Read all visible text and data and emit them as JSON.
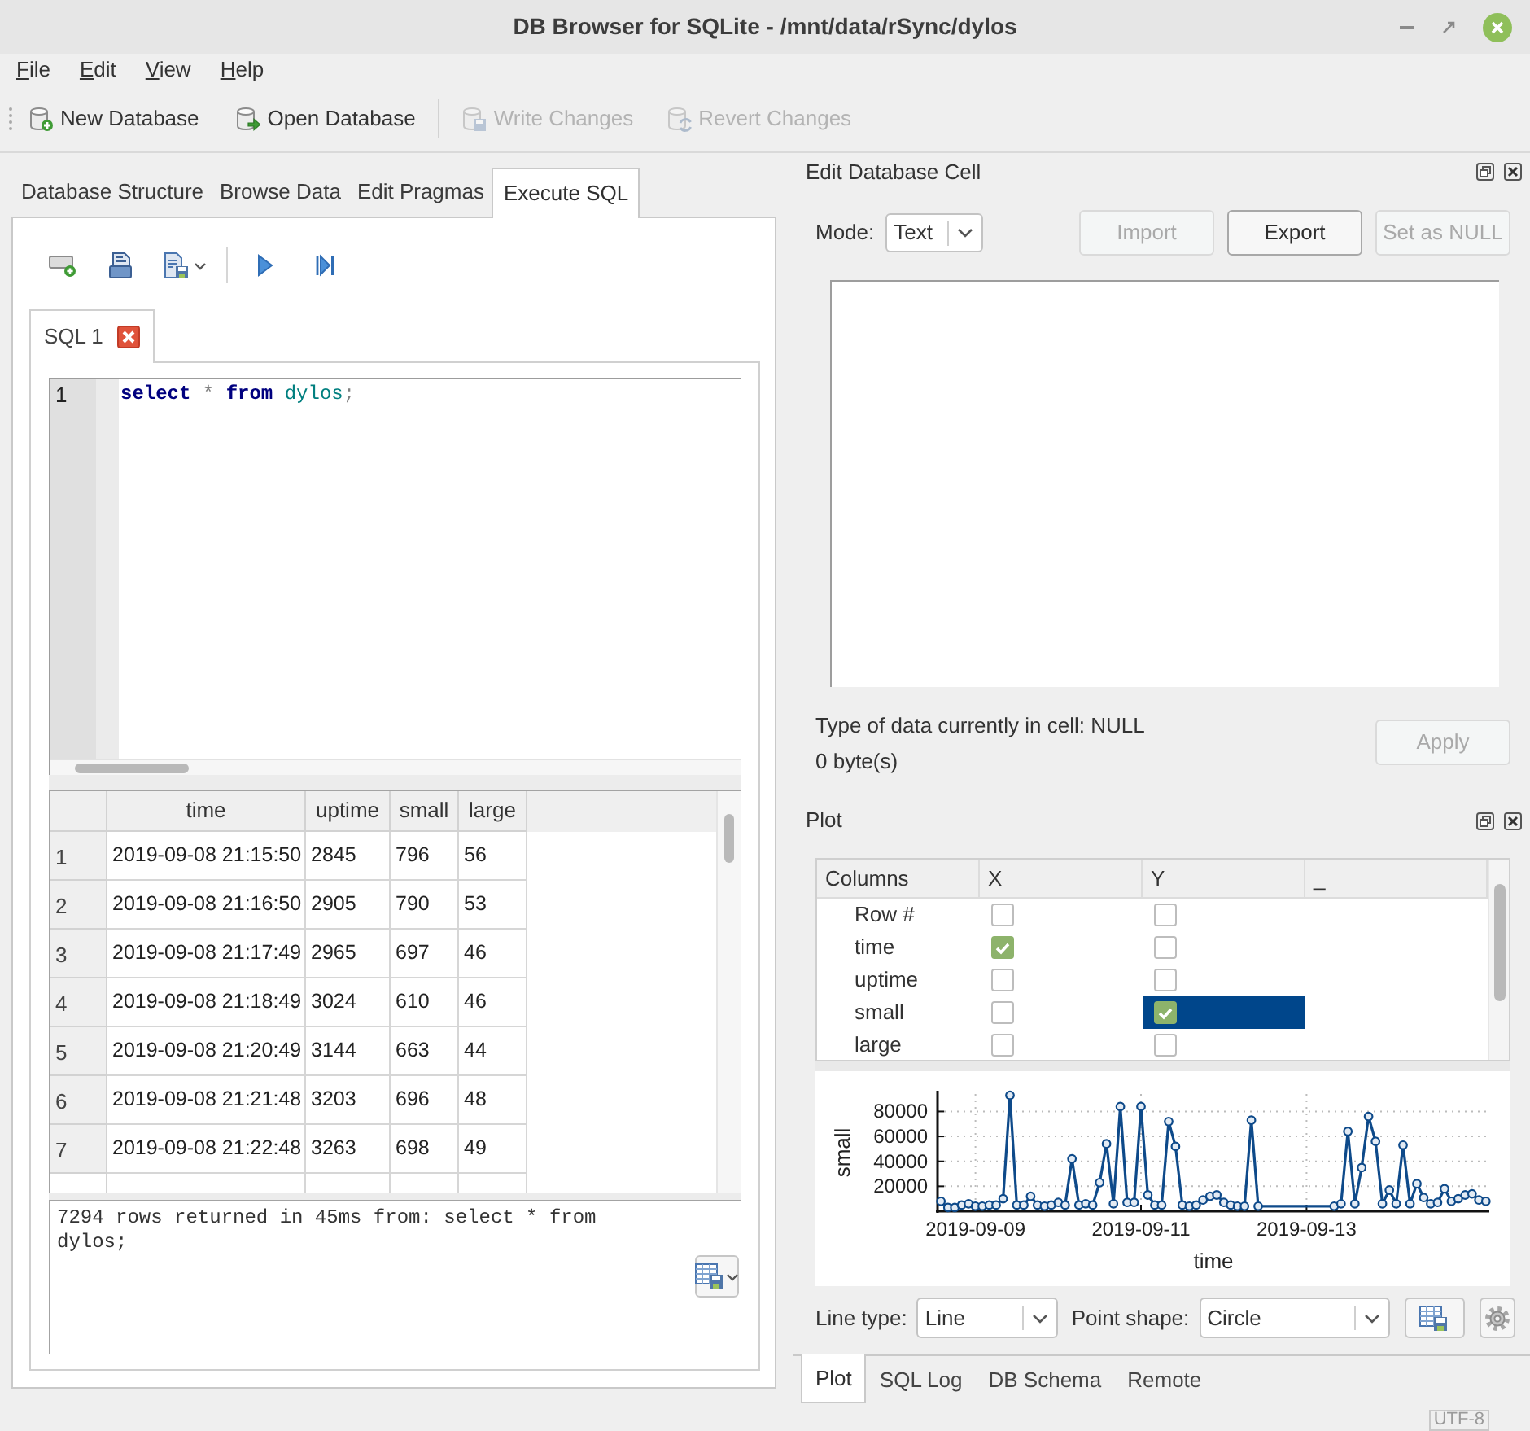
{
  "window": {
    "title": "DB Browser for SQLite - /mnt/data/rSync/dylos"
  },
  "menu": [
    "File",
    "Edit",
    "View",
    "Help"
  ],
  "toolbar": {
    "groups": [
      [
        {
          "label": "New Database",
          "disabled": false
        },
        {
          "label": "Open Database",
          "disabled": false
        }
      ],
      [
        {
          "label": "Write Changes",
          "disabled": true
        },
        {
          "label": "Revert Changes",
          "disabled": true
        }
      ]
    ]
  },
  "main_tabs": [
    {
      "label": "Database Structure",
      "selected": false
    },
    {
      "label": "Browse Data",
      "selected": false
    },
    {
      "label": "Edit Pragmas",
      "selected": false
    },
    {
      "label": "Execute SQL",
      "selected": true
    }
  ],
  "sql_tabs": [
    {
      "label": "SQL 1",
      "selected": true
    }
  ],
  "editor": {
    "lines": [
      {
        "number": "1",
        "tokens": [
          {
            "text": "select ",
            "kind": "keyword"
          },
          {
            "text": "* ",
            "kind": "operator"
          },
          {
            "text": "from ",
            "kind": "keyword"
          },
          {
            "text": "dylos",
            "kind": "identifier"
          },
          {
            "text": ";",
            "kind": "operator"
          }
        ]
      }
    ]
  },
  "results": {
    "columns": [
      "time",
      "uptime",
      "small",
      "large"
    ],
    "rows": [
      {
        "header": "1",
        "cells": [
          "2019-09-08 21:15:50",
          "2845",
          "796",
          "56"
        ]
      },
      {
        "header": "2",
        "cells": [
          "2019-09-08 21:16:50",
          "2905",
          "790",
          "53"
        ]
      },
      {
        "header": "3",
        "cells": [
          "2019-09-08 21:17:49",
          "2965",
          "697",
          "46"
        ]
      },
      {
        "header": "4",
        "cells": [
          "2019-09-08 21:18:49",
          "3024",
          "610",
          "46"
        ]
      },
      {
        "header": "5",
        "cells": [
          "2019-09-08 21:20:49",
          "3144",
          "663",
          "44"
        ]
      },
      {
        "header": "6",
        "cells": [
          "2019-09-08 21:21:48",
          "3203",
          "696",
          "48"
        ]
      },
      {
        "header": "7",
        "cells": [
          "2019-09-08 21:22:48",
          "3263",
          "698",
          "49"
        ]
      }
    ]
  },
  "message": "7294 rows returned in 45ms from: select * from dylos;",
  "edit_cell": {
    "title": "Edit Database Cell",
    "mode_label": "Mode:",
    "mode": "Text",
    "buttons": [
      {
        "label": "Import",
        "disabled": true
      },
      {
        "label": "Export",
        "disabled": false
      },
      {
        "label": "Set as NULL",
        "disabled": true
      }
    ],
    "type_info": "Type of data currently in cell: NULL",
    "size_info": "0 byte(s)",
    "apply": {
      "label": "Apply",
      "disabled": true
    }
  },
  "plot": {
    "title": "Plot",
    "columns_table": {
      "headers": [
        "Columns",
        "X",
        "Y",
        "_"
      ],
      "rows": [
        {
          "name": "Row #",
          "x": {
            "checked": false,
            "selected": false
          },
          "y": {
            "checked": false,
            "selected": false
          }
        },
        {
          "name": "time",
          "x": {
            "checked": true,
            "selected": false
          },
          "y": {
            "checked": false,
            "selected": false
          }
        },
        {
          "name": "uptime",
          "x": {
            "checked": false,
            "selected": false
          },
          "y": {
            "checked": false,
            "selected": false
          }
        },
        {
          "name": "small",
          "x": {
            "checked": false,
            "selected": false
          },
          "y": {
            "checked": true,
            "selected": true
          }
        },
        {
          "name": "large",
          "x": {
            "checked": false,
            "selected": false
          },
          "y": {
            "checked": false,
            "selected": false
          }
        }
      ]
    },
    "chart_data": {
      "type": "line",
      "grid": true,
      "xlabel": "time",
      "ylabel": "small",
      "categories": [
        null,
        null,
        null,
        null,
        null,
        "2019-09-09",
        null,
        null,
        null,
        null,
        null,
        null,
        null,
        null,
        null,
        null,
        null,
        null,
        null,
        null,
        null,
        null,
        null,
        null,
        null,
        null,
        null,
        null,
        null,
        "2019-09-11",
        null,
        null,
        null,
        null,
        null,
        null,
        null,
        null,
        null,
        null,
        null,
        null,
        null,
        null,
        null,
        null,
        null,
        null,
        null,
        null,
        null,
        null,
        null,
        "2019-09-13",
        null,
        null,
        null,
        null,
        null,
        null,
        null,
        null,
        null,
        null,
        null,
        null,
        null,
        null,
        null,
        null,
        null,
        null,
        null,
        null,
        null,
        null,
        null,
        null,
        null,
        null
      ],
      "series": [
        {
          "color": "#0e4a8a",
          "marker": "circle",
          "values": [
            8000,
            3000,
            3000,
            5000,
            6000,
            4000,
            4000,
            5000,
            5000,
            10000,
            93000,
            5000,
            5000,
            12000,
            5000,
            4000,
            5000,
            7000,
            5000,
            42000,
            5000,
            6000,
            5000,
            23000,
            54000,
            6000,
            84000,
            7000,
            7000,
            84000,
            13000,
            5000,
            5000,
            72000,
            52000,
            5000,
            4000,
            5000,
            9000,
            12000,
            13000,
            7000,
            5000,
            4000,
            4000,
            73000,
            4000,
            null,
            null,
            null,
            null,
            null,
            null,
            null,
            null,
            null,
            null,
            4000,
            6000,
            64000,
            6000,
            35000,
            76000,
            56000,
            6000,
            17000,
            6000,
            53000,
            6000,
            22000,
            11000,
            6000,
            7000,
            18000,
            8000,
            10000,
            13000,
            14000,
            9000,
            8000
          ]
        }
      ],
      "ylim": [
        0,
        94000
      ],
      "yticks": [
        20000,
        40000,
        60000,
        80000
      ]
    },
    "line_type_label": "Line type:",
    "line_type": "Line",
    "point_shape_label": "Point shape:",
    "point_shape": "Circle"
  },
  "bottom_tabs": [
    {
      "label": "Plot",
      "selected": true
    },
    {
      "label": "SQL Log",
      "selected": false
    },
    {
      "label": "DB Schema",
      "selected": false
    },
    {
      "label": "Remote",
      "selected": false
    }
  ],
  "status_bar": {
    "encoding": "UTF-8"
  }
}
